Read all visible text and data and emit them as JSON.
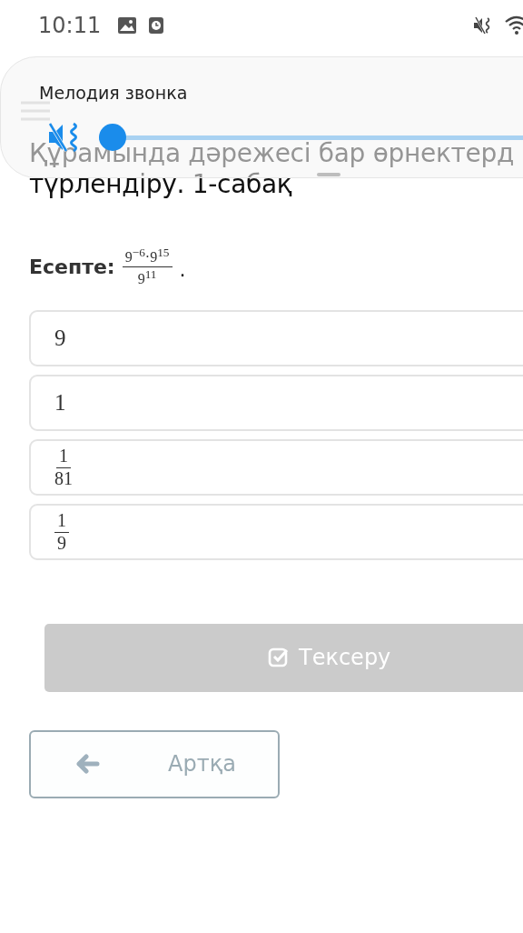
{
  "status_bar": {
    "time": "10:11"
  },
  "volume_panel": {
    "title": "Мелодия звонка",
    "muted": true,
    "level": 0.0
  },
  "lesson": {
    "title_lines": [
      "Құрамында дәрежесі бар өрнектерд",
      "түрлендіру. 1-сабақ"
    ]
  },
  "question": {
    "label": "Есепте:",
    "numerator": "9$^{−6}$·9$^{15}$",
    "denominator": "9$^{11}$",
    "end": "."
  },
  "options": [
    {
      "kind": "number",
      "text": "9"
    },
    {
      "kind": "number",
      "text": "1"
    },
    {
      "kind": "fraction",
      "numerator": "1",
      "denominator": "81"
    },
    {
      "kind": "fraction",
      "numerator": "1",
      "denominator": "9"
    }
  ],
  "check_button": {
    "label": "Тексеру",
    "disabled": true
  },
  "back_button": {
    "label": "Артқа"
  }
}
